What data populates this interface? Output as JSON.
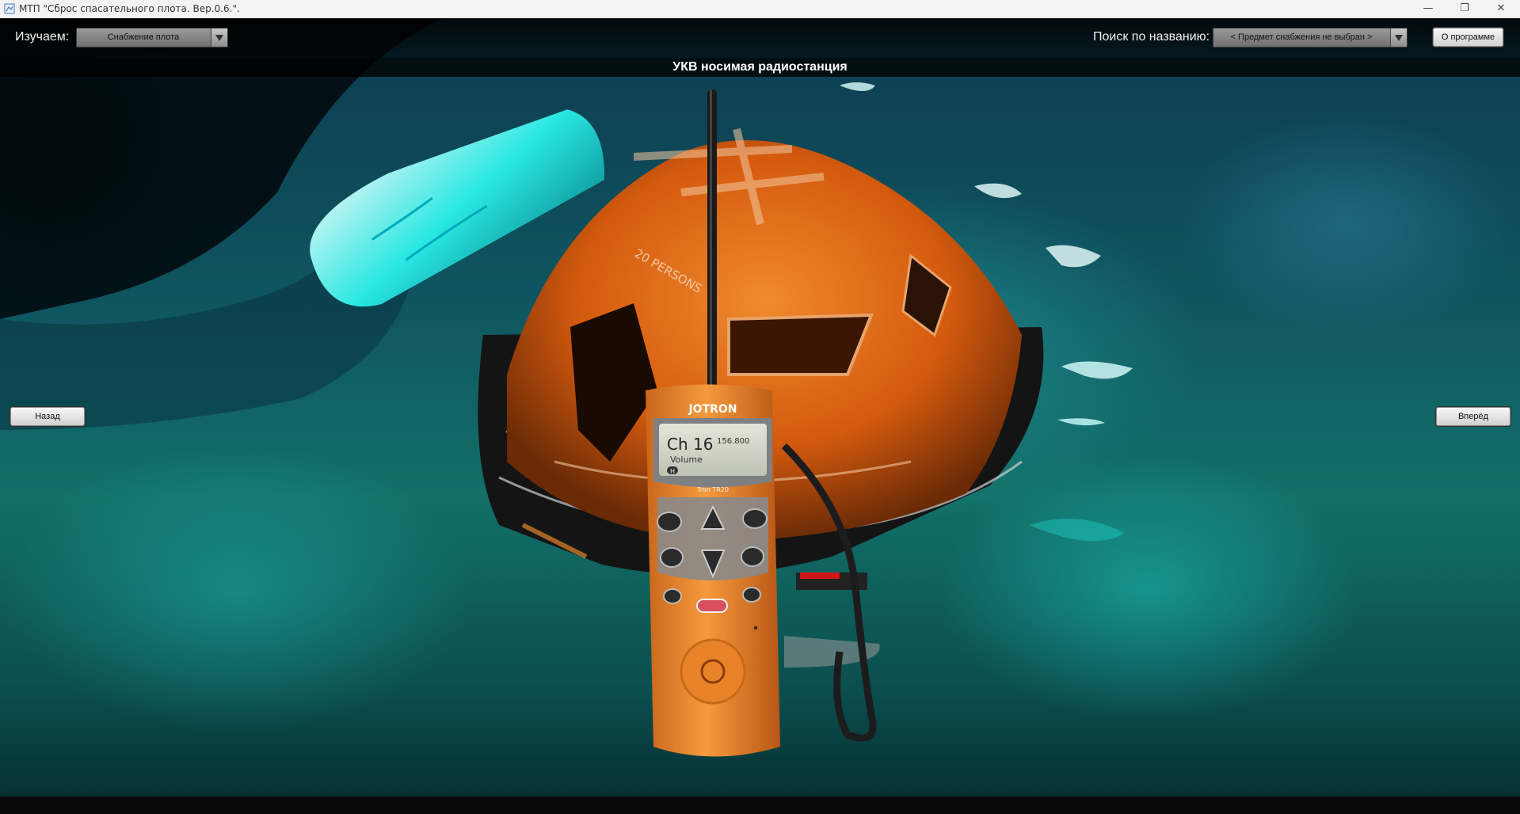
{
  "window": {
    "title": "МТП \"Сброс спасательного плота. Вер.0.6.\".",
    "minimize_glyph": "—",
    "maximize_glyph": "❐",
    "close_glyph": "✕"
  },
  "toolbar": {
    "study_label": "Изучаем:",
    "study_select_value": "Снабжение плота",
    "search_label": "Поиск по названию:",
    "search_select_value": "< Предмет снабжения не выбран >",
    "about_button": "О программе"
  },
  "item": {
    "title": "УКВ носимая радиостанция"
  },
  "navigation": {
    "back_button": "Назад",
    "forward_button": "Вперёд"
  },
  "scene_text": {
    "raft_marking": "20 PERSONS",
    "radio_brand": "JOTRON",
    "radio_model": "Tron TR20",
    "radio_channel": "Ch 16",
    "radio_frequency": "156.800",
    "radio_menu": "Volume",
    "radio_softkey": "H"
  },
  "colors": {
    "raft_orange": "#e56a12",
    "water": "#127068",
    "radio_orange": "#f08a2a"
  }
}
